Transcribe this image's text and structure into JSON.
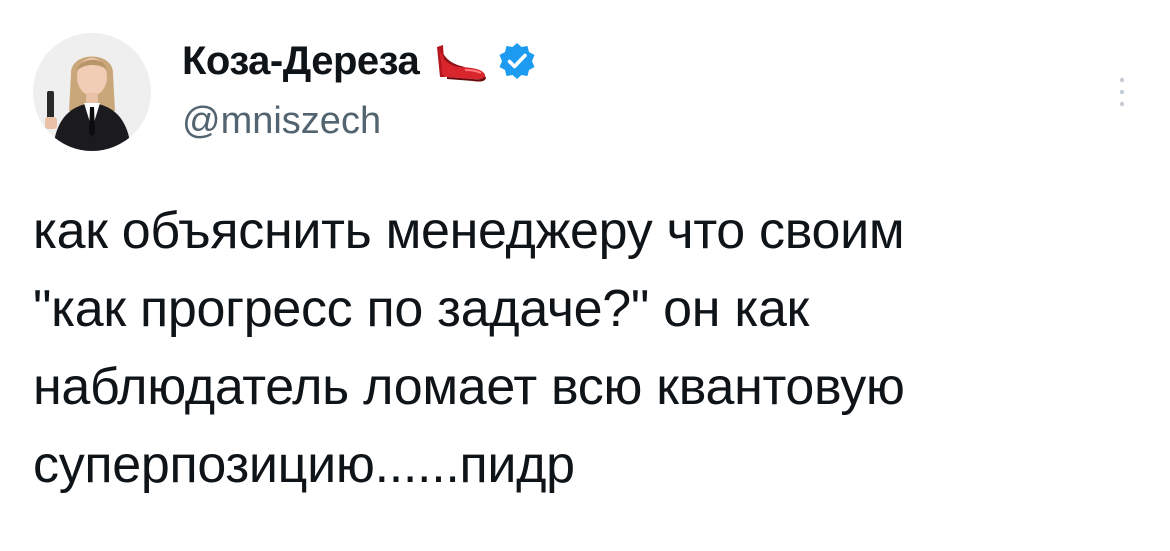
{
  "tweet": {
    "author": {
      "display_name": "Коза-Дереза",
      "handle": "@mniszech",
      "name_emoji": "high-heel-shoe-icon",
      "verified": true,
      "avatar": "avatar-photo"
    },
    "text_lines": [
      "как объяснить менеджеру что своим",
      "\"как прогресс по задаче?\" он как",
      "наблюдатель ломает всю квантовую",
      "суперпозицию......пидр"
    ],
    "more_menu_icon": "more-vertical-icon"
  },
  "colors": {
    "text_primary": "#0f1419",
    "text_secondary": "#536471",
    "verified_blue": "#1d9bf0",
    "shoe_red": "#d9262c",
    "background": "#ffffff"
  }
}
